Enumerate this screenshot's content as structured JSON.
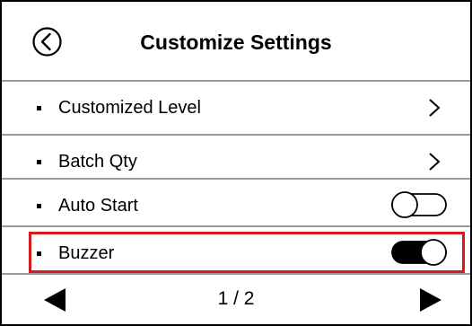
{
  "header": {
    "title": "Customize Settings",
    "back_icon": "back-circle-icon"
  },
  "settings": [
    {
      "label": "Customized Level",
      "control": "chevron-right-icon"
    },
    {
      "label": "Batch Qty",
      "control": "chevron-right-icon"
    },
    {
      "label": "Auto Start",
      "control": "toggle",
      "enabled": false
    },
    {
      "label": "Buzzer",
      "control": "toggle",
      "enabled": true,
      "highlighted": true
    }
  ],
  "footer": {
    "page_indicator": "1 / 2",
    "prev_icon": "triangle-left-icon",
    "next_icon": "triangle-right-icon"
  },
  "colors": {
    "border": "#000000",
    "divider": "#9a9a9a",
    "highlight": "#d71920",
    "toggle_on": "#000000"
  }
}
